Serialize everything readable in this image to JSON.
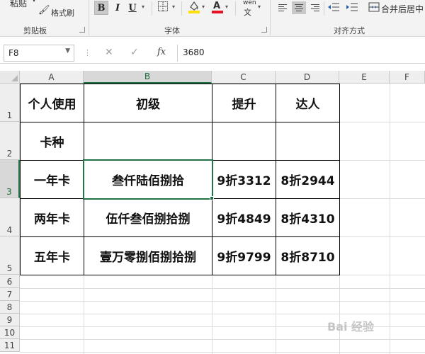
{
  "ribbon": {
    "clipboard": {
      "paste_label": "粘贴",
      "format_painter_label": "格式刷",
      "group_label": "剪贴板"
    },
    "font": {
      "bold": "B",
      "italic": "I",
      "underline": "U",
      "phonetic": "wén",
      "group_label": "字体",
      "highlight_color": "#ffe100",
      "font_color": "#e81123"
    },
    "alignment": {
      "merge_label": "合并后居中",
      "group_label": "对齐方式"
    }
  },
  "formula_bar": {
    "name_box": "F8",
    "cancel_icon": "✕",
    "enter_icon": "✓",
    "fx": "fx",
    "formula": "3680"
  },
  "sheet": {
    "columns": [
      "A",
      "B",
      "C",
      "D",
      "E",
      "F"
    ],
    "selected_column": "B",
    "rows": [
      "1",
      "2",
      "3",
      "4",
      "5",
      "6",
      "7",
      "8",
      "9",
      "10",
      "11"
    ],
    "selected_row": "3",
    "cells": {
      "A1": "个人使用",
      "B1": "初级",
      "C1": "提升",
      "D1": "达人",
      "A2": "卡种",
      "A3": "一年卡",
      "B3": "叁仟陆佰捌拾",
      "C3": "9折3312",
      "D3": "8折2944",
      "A4": "两年卡",
      "B4": "伍仟叁佰捌拾捌",
      "C4": "9折4849",
      "D4": "8折4310",
      "A5": "五年卡",
      "B5": "壹万零捌佰捌拾捌",
      "C5": "9折9799",
      "D5": "8折8710"
    },
    "accent_color": "#217346"
  },
  "watermark": "Bai 经验"
}
